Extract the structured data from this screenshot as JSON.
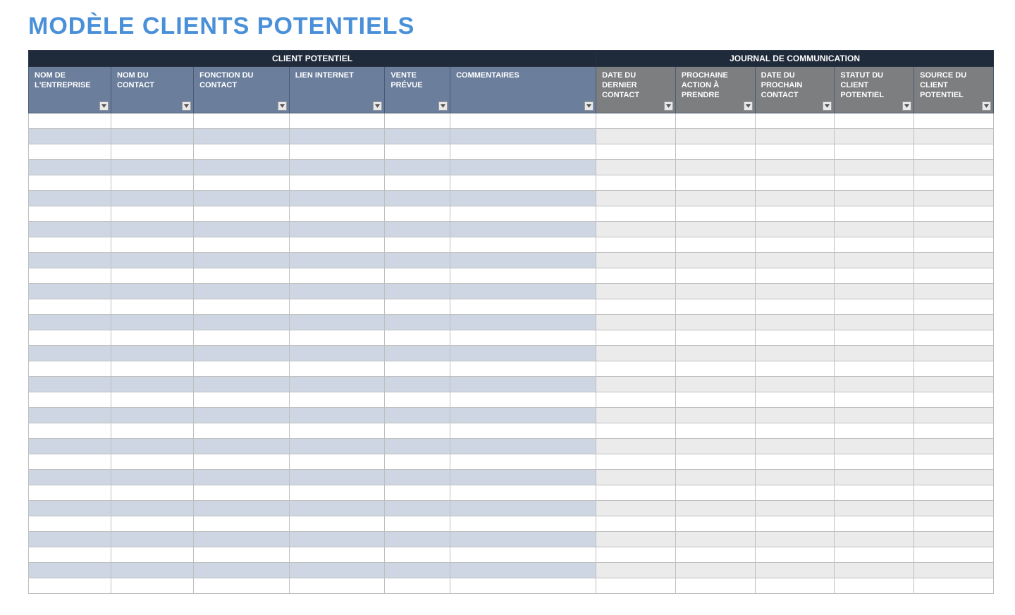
{
  "title": "MODÈLE CLIENTS POTENTIELS",
  "sections": {
    "left": "CLIENT POTENTIEL",
    "right": "JOURNAL DE COMMUNICATION"
  },
  "columns": [
    {
      "id": "nom_entreprise",
      "label": "NOM DE L'ENTREPRISE",
      "group": "left"
    },
    {
      "id": "nom_contact",
      "label": "NOM DU CONTACT",
      "group": "left"
    },
    {
      "id": "fonction_contact",
      "label": "FONCTION DU CONTACT",
      "group": "left"
    },
    {
      "id": "lien_internet",
      "label": "LIEN INTERNET",
      "group": "left"
    },
    {
      "id": "vente_prevue",
      "label": "VENTE PRÉVUE",
      "group": "left"
    },
    {
      "id": "commentaires",
      "label": "COMMENTAIRES",
      "group": "left"
    },
    {
      "id": "date_dernier_contact",
      "label": "DATE DU DERNIER CONTACT",
      "group": "right"
    },
    {
      "id": "prochaine_action",
      "label": "PROCHAINE ACTION À PRENDRE",
      "group": "right"
    },
    {
      "id": "date_prochain_contact",
      "label": "DATE DU PROCHAIN CONTACT",
      "group": "right"
    },
    {
      "id": "statut_client",
      "label": "STATUT DU CLIENT POTENTIEL",
      "group": "right"
    },
    {
      "id": "source_client",
      "label": "SOURCE DU CLIENT POTENTIEL",
      "group": "right"
    }
  ],
  "row_count": 31,
  "rows": []
}
